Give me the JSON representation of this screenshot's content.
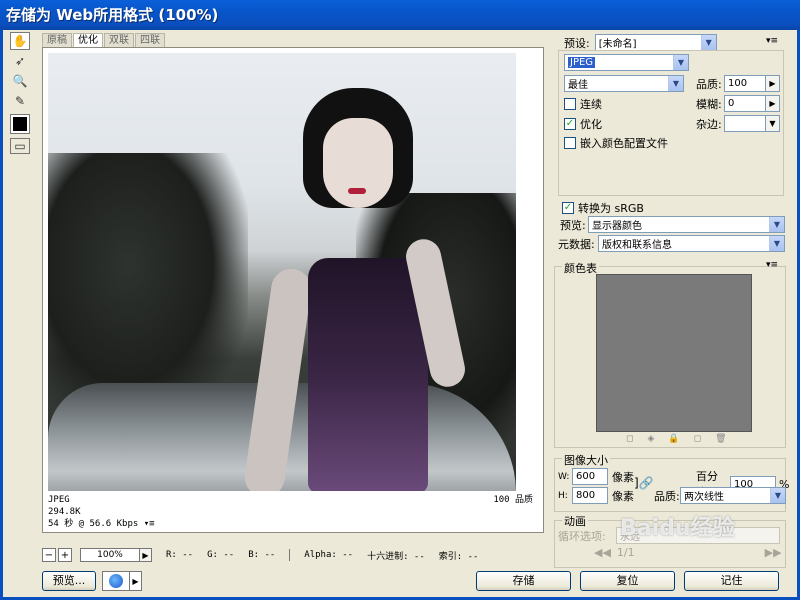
{
  "window": {
    "title": "存储为 Web所用格式 (100%)"
  },
  "tools": [
    "hand-icon",
    "slice-select-icon",
    "zoom-icon",
    "eyedropper-icon"
  ],
  "view_tabs": [
    "原稿",
    "优化",
    "双联",
    "四联"
  ],
  "image_info": {
    "format": "JPEG",
    "size": "294.8K",
    "time": "54 秒 @ 56.6 Kbps",
    "quality_label": "100 品质"
  },
  "status": {
    "zoom": "100%",
    "r": "R: --",
    "g": "G: --",
    "b": "B: --",
    "alpha": "Alpha: --",
    "hex": "十六进制: --",
    "index": "索引: --"
  },
  "buttons": {
    "preview": "预览...",
    "save": "存储",
    "reset": "复位",
    "remember": "记住"
  },
  "settings": {
    "preset_label": "预设:",
    "preset_value": "[未命名]",
    "format_value": "JPEG",
    "quality_preset": "最佳",
    "quality_label": "品质:",
    "quality_value": "100",
    "progressive_label": "连续",
    "blur_label": "模糊:",
    "blur_value": "0",
    "optimized_label": "优化",
    "matte_label": "杂边:",
    "embed_profile_label": "嵌入颜色配置文件",
    "convert_srgb_label": "转换为 sRGB",
    "preview_label": "预览:",
    "preview_value": "显示器颜色",
    "metadata_label": "元数据:",
    "metadata_value": "版权和联系信息"
  },
  "color_table": {
    "title": "颜色表"
  },
  "image_size": {
    "title": "图像大小",
    "w_label": "W:",
    "w_value": "600",
    "h_label": "H:",
    "h_value": "800",
    "unit": "像素",
    "percent_label": "百分比:",
    "percent_value": "100",
    "percent_unit": "%",
    "quality_label": "品质:",
    "quality_value": "两次线性"
  },
  "animation": {
    "title": "动画",
    "loop_label": "循环选项:",
    "loop_value": "永远",
    "frame": "1/1"
  },
  "watermark": "Baidu经验"
}
